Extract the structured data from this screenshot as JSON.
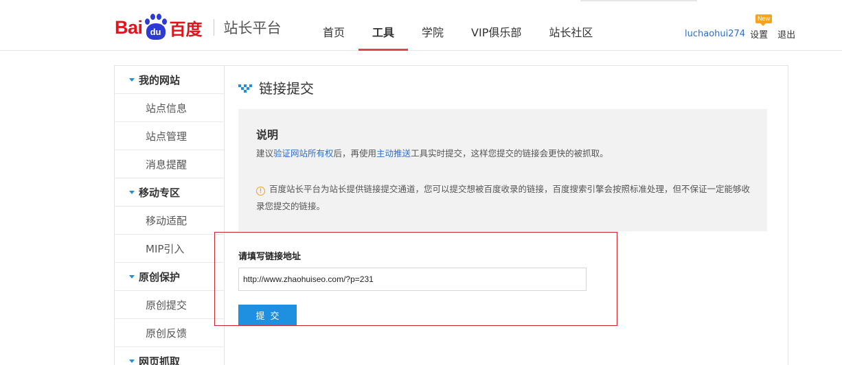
{
  "brand": {
    "logo_bai": "Bai",
    "logo_du": "du",
    "logo_cn": "百度",
    "subtitle": "站长平台",
    "logo_color": "#e4131b",
    "paw_color": "#2d3ad6"
  },
  "nav": {
    "items": [
      {
        "label": "首页"
      },
      {
        "label": "工具"
      },
      {
        "label": "学院"
      },
      {
        "label": "VIP俱乐部"
      },
      {
        "label": "站长社区"
      }
    ],
    "active": "工具",
    "active_color": "#e0454e"
  },
  "user": {
    "name": "luchaohui274",
    "settings_label": "设置",
    "new_badge": "New",
    "logout_label": "退出"
  },
  "sidebar": {
    "rows": [
      {
        "type": "group",
        "label": "我的网站"
      },
      {
        "type": "sub",
        "label": "站点信息"
      },
      {
        "type": "sub",
        "label": "站点管理"
      },
      {
        "type": "sub",
        "label": "消息提醒"
      },
      {
        "type": "group",
        "label": "移动专区"
      },
      {
        "type": "sub",
        "label": "移动适配"
      },
      {
        "type": "sub",
        "label": "MIP引入"
      },
      {
        "type": "group",
        "label": "原创保护"
      },
      {
        "type": "sub",
        "label": "原创提交"
      },
      {
        "type": "sub",
        "label": "原创反馈"
      },
      {
        "type": "group",
        "label": "网页抓取"
      }
    ],
    "accent_color": "#1f8fe0"
  },
  "main": {
    "title": "链接提交",
    "info": {
      "heading": "说明",
      "line_prefix": "建议",
      "link1": "验证网站所有权",
      "line_mid": "后，再使用",
      "link2": "主动推送",
      "line_suffix": "工具实时提交，这样您提交的链接会更快的被抓取。",
      "warning_text": "百度站长平台为站长提供链接提交通道，您可以提交想被百度收录的链接，百度搜索引擎会按照标准处理，但不保证一定能够收录您提交的链接。"
    },
    "form": {
      "label": "请填写链接地址",
      "url_value": "http://www.zhaohuiseo.com/?p=231",
      "submit_label": "提交"
    }
  }
}
